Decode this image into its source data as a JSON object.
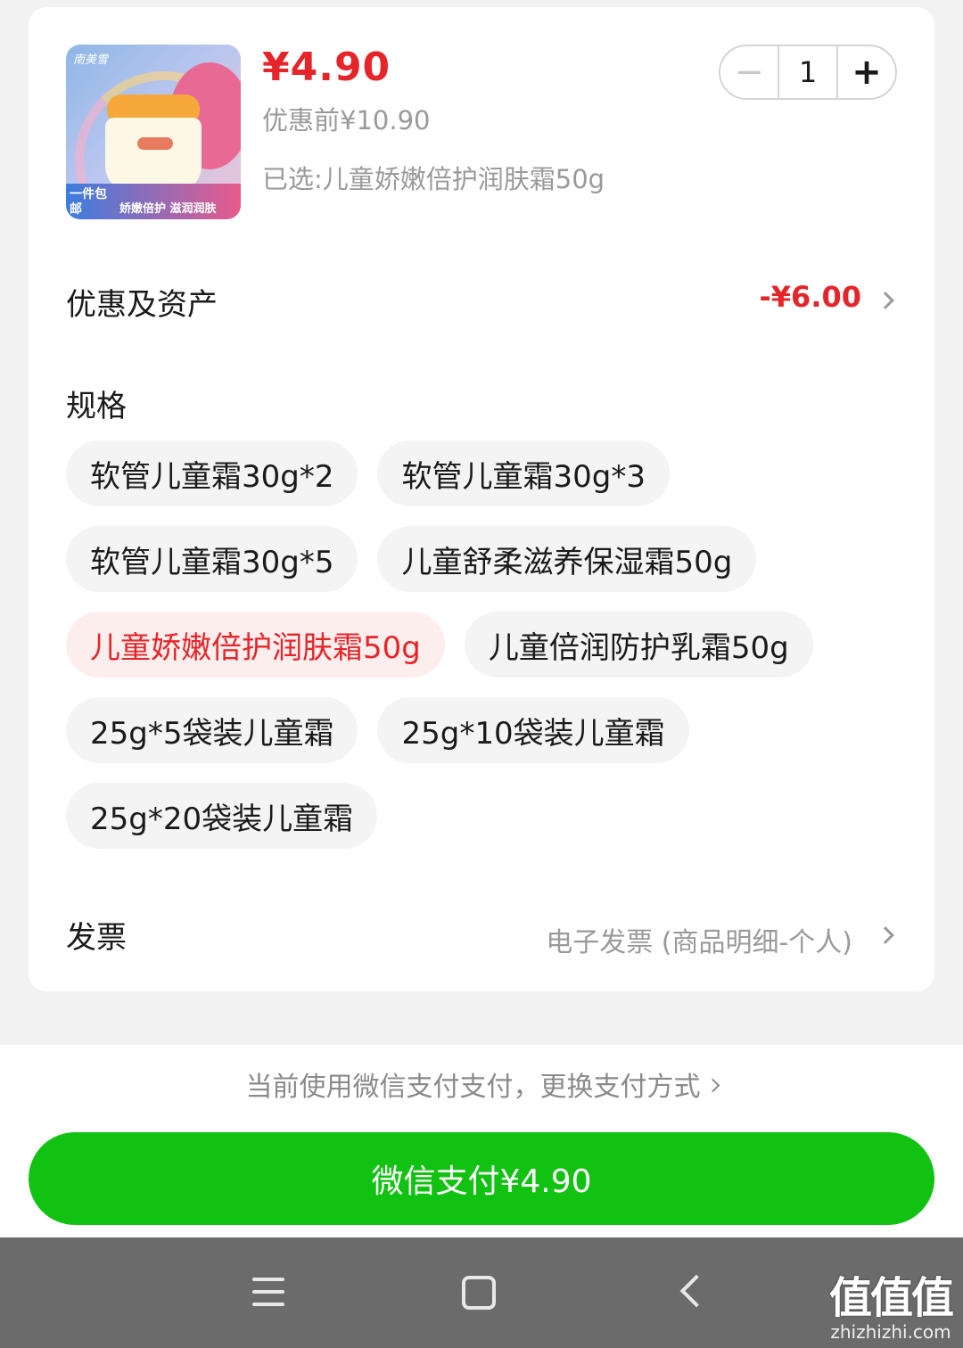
{
  "product": {
    "brand_text": "南美雪",
    "badge_left": "一件包邮",
    "badge_right": "娇嫩倍护 滋润润肤",
    "price": "¥4.90",
    "original_price": "优惠前¥10.90",
    "selected": "已选:儿童娇嫩倍护润肤霜50g"
  },
  "quantity": {
    "value": "1",
    "minus": "−",
    "plus": "+"
  },
  "discount": {
    "label": "优惠及资产",
    "value": "-¥6.00"
  },
  "spec": {
    "label": "规格",
    "rows": [
      [
        "软管儿童霜30g*2",
        "软管儿童霜30g*3"
      ],
      [
        "软管儿童霜30g*5",
        "儿童舒柔滋养保湿霜50g"
      ],
      [
        "儿童娇嫩倍护润肤霜50g",
        "儿童倍润防护乳霜50g"
      ],
      [
        "25g*5袋装儿童霜",
        "25g*10袋装儿童霜"
      ],
      [
        "25g*20袋装儿童霜"
      ]
    ],
    "selected_option": "儿童娇嫩倍护润肤霜50g"
  },
  "invoice": {
    "label": "发票",
    "value": "电子发票 (商品明细-个人)"
  },
  "payment": {
    "method_text": "当前使用微信支付支付，更换支付方式",
    "button_label": "微信支付¥4.90"
  },
  "watermark": {
    "big": "值值值",
    "small": "zhizhizhi.com"
  },
  "colors": {
    "accent_red": "#e5252a",
    "pay_green": "#12c212"
  }
}
